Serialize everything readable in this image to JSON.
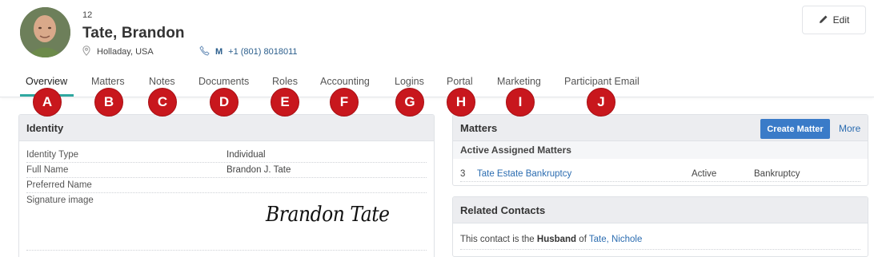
{
  "header": {
    "contact_id": "12",
    "name": "Tate, Brandon",
    "location": "Holladay, USA",
    "phone_type": "M",
    "phone": "+1 (801) 8018011",
    "edit_label": "Edit"
  },
  "tabs": [
    {
      "label": "Overview",
      "badge": "A"
    },
    {
      "label": "Matters",
      "badge": "B"
    },
    {
      "label": "Notes",
      "badge": "C"
    },
    {
      "label": "Documents",
      "badge": "D"
    },
    {
      "label": "Roles",
      "badge": "E"
    },
    {
      "label": "Accounting",
      "badge": "F"
    },
    {
      "label": "Logins",
      "badge": "G"
    },
    {
      "label": "Portal",
      "badge": "H"
    },
    {
      "label": "Marketing",
      "badge": "I"
    },
    {
      "label": "Participant Email",
      "badge": "J"
    }
  ],
  "identity": {
    "title": "Identity",
    "rows": [
      {
        "label": "Identity Type",
        "value": "Individual"
      },
      {
        "label": "Full Name",
        "value": "Brandon J. Tate"
      },
      {
        "label": "Preferred Name",
        "value": ""
      },
      {
        "label": "Signature image",
        "value": ""
      }
    ],
    "signature": "Brandon Tate"
  },
  "matters": {
    "title": "Matters",
    "create_label": "Create Matter",
    "more_label": "More",
    "subhead": "Active Assigned Matters",
    "rows": [
      {
        "num": "3",
        "name": "Tate Estate Bankruptcy",
        "status": "Active",
        "type": "Bankruptcy"
      }
    ]
  },
  "related": {
    "title": "Related Contacts",
    "prefix": "This contact is the",
    "relation": "Husband",
    "of": "of",
    "contact": "Tate, Nichole"
  },
  "colors": {
    "accent": "#2fa8a0",
    "badge": "#c8171d",
    "primary_button": "#3a7bc8",
    "link": "#2b6cb0"
  }
}
